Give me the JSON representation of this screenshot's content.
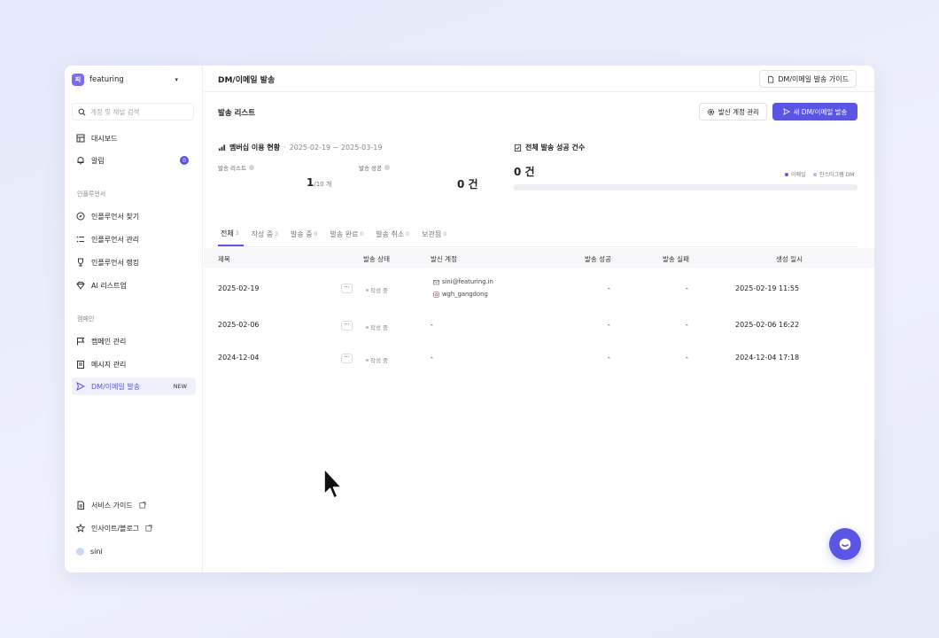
{
  "sidebar": {
    "workspace": {
      "logo": "피",
      "name": "featuring"
    },
    "search_placeholder": "계정 및 채널 검색",
    "items": [
      {
        "label": "대시보드",
        "icon": "dashboard-icon"
      },
      {
        "label": "알림",
        "icon": "bell-icon",
        "badge": "0"
      }
    ],
    "section_influencer": "인플루언서",
    "influencer_items": [
      {
        "label": "인플루언서 찾기",
        "icon": "compass-icon"
      },
      {
        "label": "인플루언서 관리",
        "icon": "list-icon"
      },
      {
        "label": "인플루언서 랭킹",
        "icon": "trophy-icon"
      },
      {
        "label": "AI 리스트업",
        "icon": "gem-icon"
      }
    ],
    "section_campaign": "캠페인",
    "campaign_items": [
      {
        "label": "캠페인 관리",
        "icon": "flag-icon"
      },
      {
        "label": "메시지 관리",
        "icon": "clipboard-icon"
      },
      {
        "label": "DM/이메일 발송",
        "icon": "send-icon",
        "tag": "NEW",
        "active": true
      }
    ],
    "bottom_items": [
      {
        "label": "서비스 가이드",
        "icon": "doc-icon"
      },
      {
        "label": "인사이트/블로그",
        "icon": "star-icon"
      },
      {
        "label": "sini",
        "icon": "avatar"
      }
    ]
  },
  "header": {
    "title": "DM/이메일 발송",
    "guide_button": "DM/이메일 발송 가이드"
  },
  "list": {
    "title": "발송 리스트",
    "manage_button": "발신 계정 관리",
    "new_button": "새 DM/이메일 발송"
  },
  "usage": {
    "title": "멤버십 이용 현황",
    "period": "2025-02-19 ~ 2025-03-19",
    "list_label": "발송 리스트",
    "list_value": "1",
    "list_total": "/10 개",
    "success_label": "발송 성공",
    "success_value": "0 건"
  },
  "total": {
    "title": "전체 발송 성공 건수",
    "value": "0 건",
    "legend_email": "이메일",
    "legend_dm": "인스타그램 DM",
    "color_email": "#5a55e4",
    "color_dm": "#b8b4f4"
  },
  "tabs": [
    {
      "label": "전체",
      "count": "3",
      "active": true
    },
    {
      "label": "작성 중",
      "count": "3"
    },
    {
      "label": "발송 중",
      "count": "0"
    },
    {
      "label": "발송 완료",
      "count": "0"
    },
    {
      "label": "발송 취소",
      "count": "0"
    },
    {
      "label": "보관됨",
      "count": "0"
    }
  ],
  "table": {
    "headers": [
      "제목",
      "발송 상태",
      "발신 계정",
      "발송 성공",
      "발송 실패",
      "생성 일시"
    ],
    "rows": [
      {
        "title": "2025-02-19",
        "status": "작성 중",
        "account_email": "sini@featuring.in",
        "account_insta": "wgh_gangdong",
        "success": "-",
        "fail": "-",
        "created": "2025-02-19 11:55"
      },
      {
        "title": "2025-02-06",
        "status": "작성 중",
        "account": "-",
        "success": "-",
        "fail": "-",
        "created": "2025-02-06 16:22"
      },
      {
        "title": "2024-12-04",
        "status": "작성 중",
        "account": "-",
        "success": "-",
        "fail": "-",
        "created": "2024-12-04 17:18"
      }
    ],
    "more_label": "···"
  },
  "accent_color": "#5a55e4"
}
